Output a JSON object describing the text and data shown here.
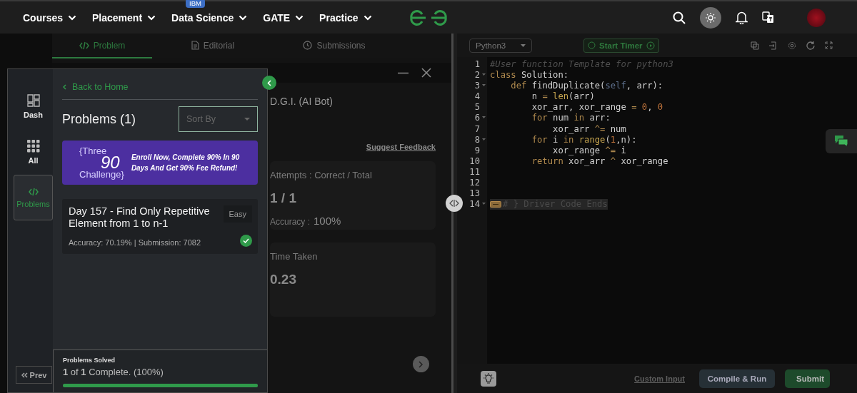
{
  "nav": {
    "items": [
      {
        "label": "Courses"
      },
      {
        "label": "Placement"
      },
      {
        "label": "Data Science",
        "badge": "IBM"
      },
      {
        "label": "GATE"
      },
      {
        "label": "Practice"
      }
    ]
  },
  "tabs": [
    {
      "label": "Problem",
      "selected": true,
      "kind": "code"
    },
    {
      "label": "Editorial",
      "selected": false,
      "kind": "doc"
    },
    {
      "label": "Submissions",
      "selected": false,
      "kind": "clock"
    }
  ],
  "stats_panel": {
    "title": "D.G.I. (AI Bot)",
    "feedback_link": "Suggest Feedback",
    "attempts": {
      "label": "Attempts : Correct / Total",
      "value": "1 / 1",
      "sub_label": "Accuracy :",
      "sub_value": "100%"
    },
    "time": {
      "label": "Time Taken",
      "value": "0.23"
    }
  },
  "drawer": {
    "rail": [
      {
        "label": "Dash",
        "selected": false,
        "kind": "dash"
      },
      {
        "label": "All",
        "selected": false,
        "kind": "grid"
      },
      {
        "label": "Problems",
        "selected": true,
        "kind": "code"
      }
    ],
    "prev_button": "Prev",
    "back_link": "Back to Home",
    "heading": "Problems (1)",
    "sort": {
      "placeholder": "Sort By"
    },
    "banner": {
      "logo_top": "{Three",
      "logo_number": "90",
      "logo_bottom": "Challenge}",
      "text": "Enroll Now, Complete 90% In 90 Days And Get 90% Fee Refund!"
    },
    "problems": [
      {
        "title": "Day 157 - Find Only Repetitive Element from 1 to n-1",
        "difficulty": "Easy",
        "stats": "Accuracy: 70.19% | Submission: 7082",
        "solved": true
      }
    ],
    "footer": {
      "label": "Problems Solved",
      "summary": "**1** of **1** Complete. (100%)",
      "level": 1
    }
  },
  "editor": {
    "language": "Python3",
    "timer_button": "Start Timer",
    "lines": [
      {
        "number": "1",
        "foldable": false,
        "tokens": [
          {
            "text": "#User function Template for python3",
            "kind": "comment"
          }
        ]
      },
      {
        "number": "2",
        "foldable": true,
        "tokens": [
          {
            "text": "class",
            "kind": "keyword"
          },
          {
            "text": " Solution:",
            "kind": "plain"
          }
        ]
      },
      {
        "number": "3",
        "foldable": true,
        "tokens": [
          {
            "text": "    def",
            "kind": "keyword"
          },
          {
            "text": " findDuplicate(",
            "kind": "plain"
          },
          {
            "text": "self",
            "kind": "self"
          },
          {
            "text": ", arr):",
            "kind": "plain"
          }
        ]
      },
      {
        "number": "4",
        "foldable": false,
        "tokens": [
          {
            "text": "        n ",
            "kind": "plain"
          },
          {
            "text": "=",
            "kind": "operator"
          },
          {
            "text": " len",
            "kind": "builtin"
          },
          {
            "text": "(arr)",
            "kind": "plain"
          }
        ]
      },
      {
        "number": "5",
        "foldable": false,
        "tokens": [
          {
            "text": "        xor_arr, xor_range ",
            "kind": "plain"
          },
          {
            "text": "=",
            "kind": "operator"
          },
          {
            "text": " 0",
            "kind": "number"
          },
          {
            "text": ",",
            "kind": "plain"
          },
          {
            "text": " 0",
            "kind": "number"
          }
        ]
      },
      {
        "number": "6",
        "foldable": true,
        "tokens": [
          {
            "text": "        for",
            "kind": "keyword"
          },
          {
            "text": " num ",
            "kind": "plain"
          },
          {
            "text": "in",
            "kind": "keyword"
          },
          {
            "text": " arr:",
            "kind": "plain"
          }
        ]
      },
      {
        "number": "7",
        "foldable": false,
        "tokens": [
          {
            "text": "            xor_arr ",
            "kind": "plain"
          },
          {
            "text": "^=",
            "kind": "operator"
          },
          {
            "text": " num",
            "kind": "plain"
          }
        ]
      },
      {
        "number": "8",
        "foldable": true,
        "tokens": [
          {
            "text": "        for",
            "kind": "keyword"
          },
          {
            "text": " i ",
            "kind": "plain"
          },
          {
            "text": "in",
            "kind": "keyword"
          },
          {
            "text": " range",
            "kind": "builtin"
          },
          {
            "text": "(",
            "kind": "plain"
          },
          {
            "text": "1",
            "kind": "number"
          },
          {
            "text": ",n):",
            "kind": "plain"
          }
        ]
      },
      {
        "number": "9",
        "foldable": false,
        "tokens": [
          {
            "text": "            xor_range ",
            "kind": "plain"
          },
          {
            "text": "^=",
            "kind": "operator"
          },
          {
            "text": " i",
            "kind": "plain"
          }
        ]
      },
      {
        "number": "10",
        "foldable": false,
        "tokens": [
          {
            "text": "        return",
            "kind": "keyword"
          },
          {
            "text": " xor_arr ",
            "kind": "plain"
          },
          {
            "text": "^",
            "kind": "operator"
          },
          {
            "text": " xor_range",
            "kind": "plain"
          }
        ]
      },
      {
        "number": "11",
        "foldable": false
      },
      {
        "number": "12",
        "foldable": false
      },
      {
        "number": "13",
        "foldable": false
      },
      {
        "number": "14",
        "foldable": true,
        "tokens": [
          {
            "text": "# } Driver Code Ends",
            "kind": "folded"
          }
        ]
      }
    ],
    "custom_input": "Custom Input",
    "buttons": [
      {
        "label": "Compile & Run",
        "kind": "secondary"
      },
      {
        "label": "Submit",
        "kind": "primary"
      }
    ]
  }
}
